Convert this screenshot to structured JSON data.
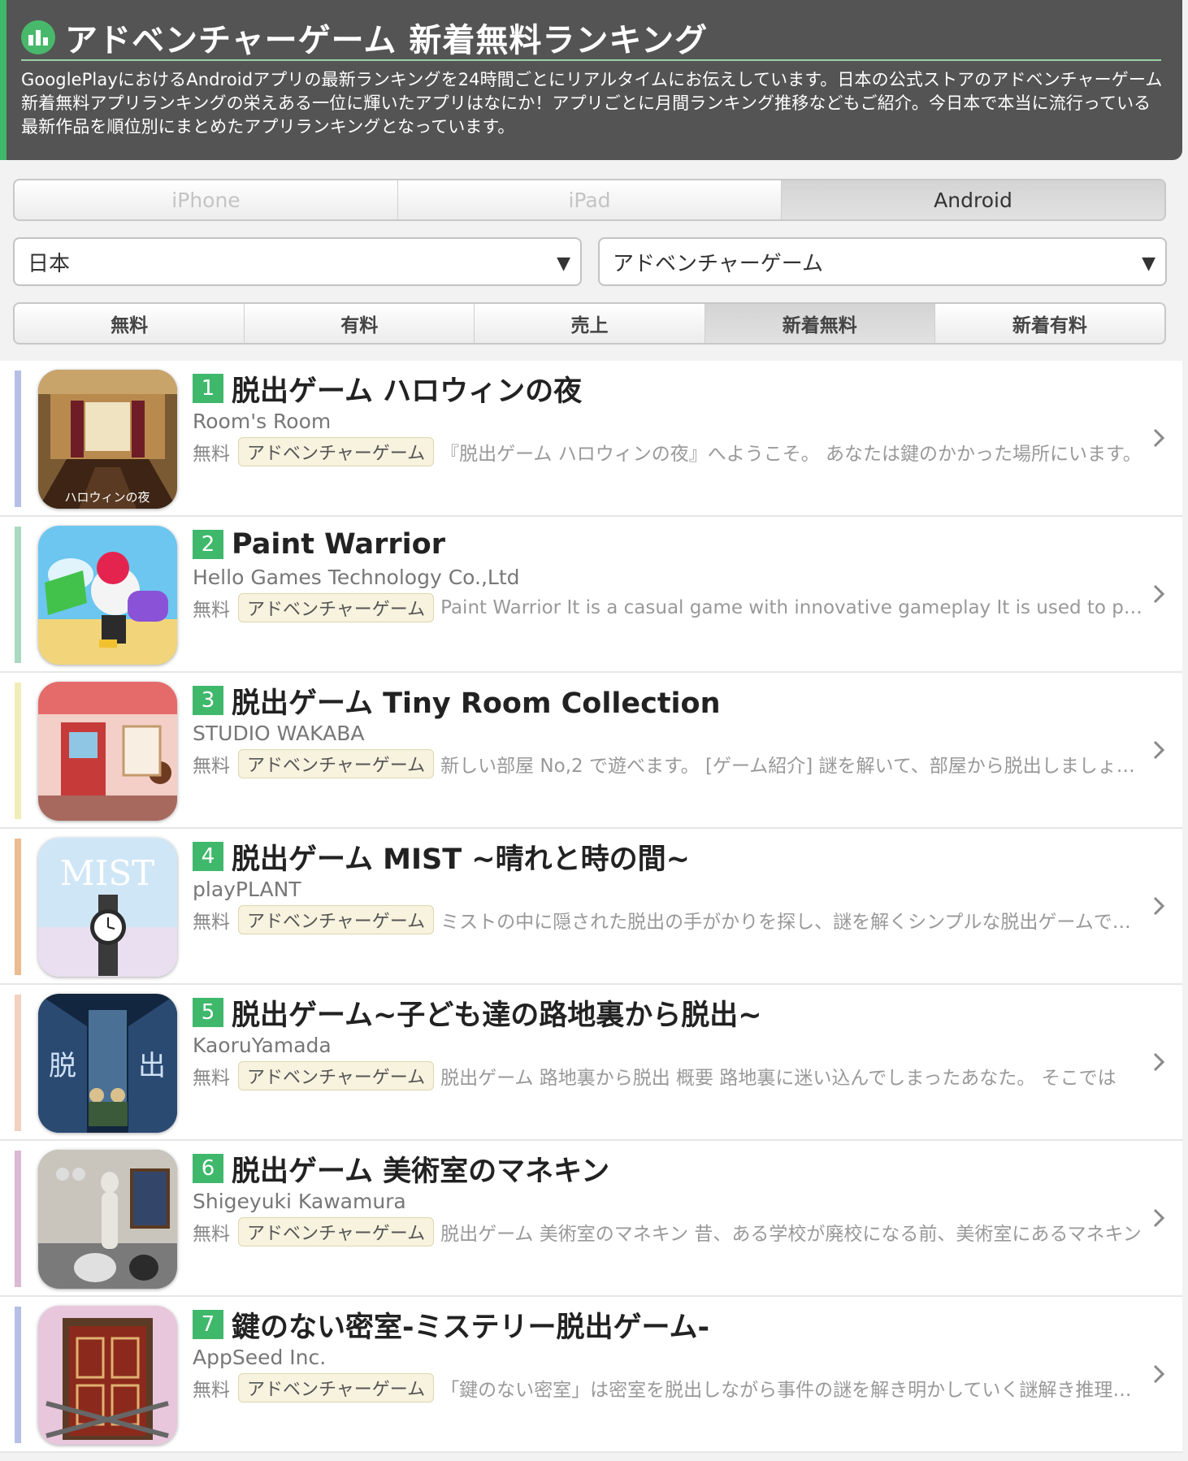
{
  "header": {
    "title": "アドベンチャーゲーム 新着無料ランキング",
    "description": "GooglePlayにおけるAndroidアプリの最新ランキングを24時間ごとにリアルタイムにお伝えしています。日本の公式ストアのアドベンチャーゲーム新着無料アプリランキングの栄えある一位に輝いたアプリはなにか！アプリごとに月間ランキング推移などもご紹介。今日本で本当に流行っている最新作品を順位別にまとめたアプリランキングとなっています。"
  },
  "device_tabs": [
    {
      "label": "iPhone",
      "active": false
    },
    {
      "label": "iPad",
      "active": false
    },
    {
      "label": "Android",
      "active": true
    }
  ],
  "selects": {
    "country": "日本",
    "genre": "アドベンチャーゲーム"
  },
  "type_tabs": [
    {
      "label": "無料",
      "active": false
    },
    {
      "label": "有料",
      "active": false
    },
    {
      "label": "売上",
      "active": false
    },
    {
      "label": "新着無料",
      "active": true
    },
    {
      "label": "新着有料",
      "active": false
    }
  ],
  "apps": [
    {
      "rank": "1",
      "title": "脱出ゲーム ハロウィンの夜",
      "developer": "Room's Room",
      "price": "無料",
      "genre": "アドベンチャーゲーム",
      "description": "『脱出ゲーム ハロウィンの夜』へようこそ。 あなたは鍵のかかった場所にいます。",
      "bar_color": "#b6bfe6"
    },
    {
      "rank": "2",
      "title": "Paint Warrior",
      "developer": "Hello Games Technology Co.,Ltd",
      "price": "無料",
      "genre": "アドベンチャーゲーム",
      "description": "Paint Warrior It is a casual game with innovative gameplay It is used to paint",
      "bar_color": "#aad9bf"
    },
    {
      "rank": "3",
      "title": "脱出ゲーム Tiny Room Collection",
      "developer": "STUDIO WAKABA",
      "price": "無料",
      "genre": "アドベンチャーゲーム",
      "description": "新しい部屋 No,2 で遊べます。 [ゲーム紹介] 謎を解いて、部屋から脱出しましょう。",
      "bar_color": "#f1edb8"
    },
    {
      "rank": "4",
      "title": "脱出ゲーム MIST ~晴れと時の間~",
      "developer": "playPLANT",
      "price": "無料",
      "genre": "アドベンチャーゲーム",
      "description": "ミストの中に隠された脱出の手がかりを探し、謎を解くシンプルな脱出ゲームです。",
      "bar_color": "#ebbc8f"
    },
    {
      "rank": "5",
      "title": "脱出ゲーム~子ども達の路地裏から脱出~",
      "developer": "KaoruYamada",
      "price": "無料",
      "genre": "アドベンチャーゲーム",
      "description": "脱出ゲーム 路地裏から脱出 概要 路地裏に迷い込んでしまったあなた。 そこでは",
      "bar_color": "#f3d0c0"
    },
    {
      "rank": "6",
      "title": "脱出ゲーム 美術室のマネキン",
      "developer": "Shigeyuki Kawamura",
      "price": "無料",
      "genre": "アドベンチャーゲーム",
      "description": "脱出ゲーム 美術室のマネキン 昔、ある学校が廃校になる前、美術室にあるマネキン",
      "bar_color": "#dbb8d4"
    },
    {
      "rank": "7",
      "title": "鍵のない密室-ミステリー脱出ゲーム-",
      "developer": "AppSeed Inc.",
      "price": "無料",
      "genre": "アドベンチャーゲーム",
      "description": "「鍵のない密室」は密室を脱出しながら事件の謎を解き明かしていく謎解き推理ゲーム",
      "bar_color": "#b6bfe6"
    }
  ],
  "icon_text": {
    "app1": "ハロウィンの夜",
    "app4": "MIST",
    "app5_left": "脱",
    "app5_right": "出"
  }
}
